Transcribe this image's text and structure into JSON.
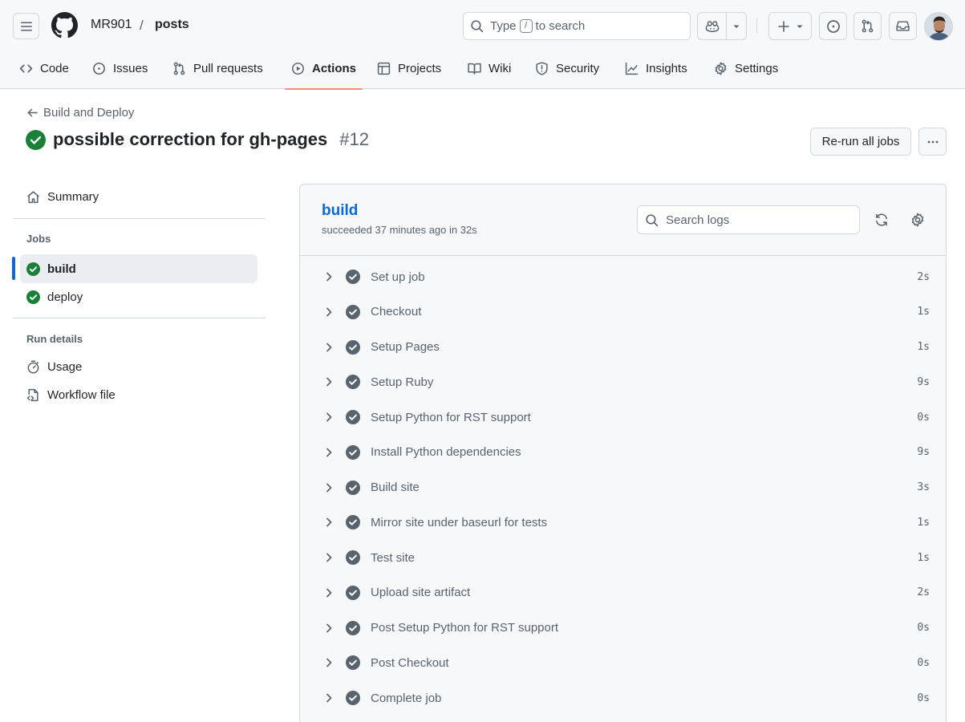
{
  "header": {
    "owner": "MR901",
    "separator": "/",
    "repo": "posts",
    "search_prefix": "Type",
    "search_key": "/",
    "search_suffix": "to search"
  },
  "nav": {
    "tabs": [
      {
        "label": "Code",
        "icon": "code-icon"
      },
      {
        "label": "Issues",
        "icon": "issue-icon"
      },
      {
        "label": "Pull requests",
        "icon": "pull-request-icon"
      },
      {
        "label": "Actions",
        "icon": "play-icon",
        "active": true
      },
      {
        "label": "Projects",
        "icon": "table-icon"
      },
      {
        "label": "Wiki",
        "icon": "book-icon"
      },
      {
        "label": "Security",
        "icon": "shield-icon"
      },
      {
        "label": "Insights",
        "icon": "graph-icon"
      },
      {
        "label": "Settings",
        "icon": "gear-icon"
      }
    ]
  },
  "run": {
    "back_label": "Build and Deploy",
    "title": "possible correction for gh-pages",
    "number": "#12",
    "rerun_label": "Re-run all jobs"
  },
  "sidebar": {
    "summary_label": "Summary",
    "jobs_heading": "Jobs",
    "jobs": [
      {
        "label": "build",
        "status": "success",
        "selected": true
      },
      {
        "label": "deploy",
        "status": "success",
        "selected": false
      }
    ],
    "run_details_heading": "Run details",
    "usage_label": "Usage",
    "workflow_label": "Workflow file"
  },
  "job": {
    "name": "build",
    "meta": "succeeded 37 minutes ago in 32s",
    "search_placeholder": "Search logs",
    "steps": [
      {
        "name": "Set up job",
        "duration": "2s"
      },
      {
        "name": "Checkout",
        "duration": "1s"
      },
      {
        "name": "Setup Pages",
        "duration": "1s"
      },
      {
        "name": "Setup Ruby",
        "duration": "9s"
      },
      {
        "name": "Setup Python for RST support",
        "duration": "0s"
      },
      {
        "name": "Install Python dependencies",
        "duration": "9s"
      },
      {
        "name": "Build site",
        "duration": "3s"
      },
      {
        "name": "Mirror site under baseurl for tests",
        "duration": "1s"
      },
      {
        "name": "Test site",
        "duration": "1s"
      },
      {
        "name": "Upload site artifact",
        "duration": "2s"
      },
      {
        "name": "Post Setup Python for RST support",
        "duration": "0s"
      },
      {
        "name": "Post Checkout",
        "duration": "0s"
      },
      {
        "name": "Complete job",
        "duration": "0s"
      }
    ]
  },
  "colors": {
    "accent": "#0969da",
    "success": "#1a7f37",
    "step_check": "#59636e",
    "active_tab_underline": "#fd8c73"
  }
}
